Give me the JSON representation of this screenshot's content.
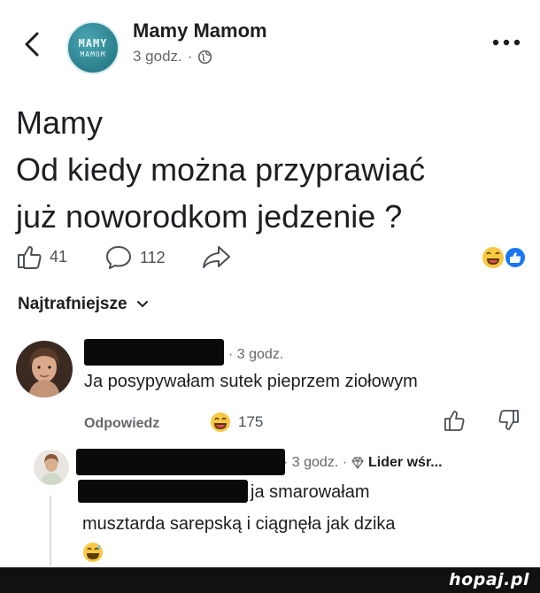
{
  "header": {
    "page_name": "Mamy Mamom",
    "time": "3 godz.",
    "separator": "·",
    "logo_text_line1": "MAMY",
    "logo_text_line2": "MAMOM"
  },
  "post": {
    "text_lines": [
      "Mamy",
      "Od kiedy można przyprawiać",
      "już noworodkom jedzenie ?"
    ]
  },
  "actions": {
    "likes": "41",
    "comments": "112"
  },
  "comments_section": {
    "sort_label": "Najtrafniejsze"
  },
  "comment1": {
    "time": "· 3 godz.",
    "text": "Ja posypywałam sutek pieprzem ziołowym",
    "reply_label": "Odpowiedz",
    "reaction_count": "175"
  },
  "comment2": {
    "time": "· 3 godz. ·",
    "badge": "Lider wśr...",
    "line1": "ja smarowałam",
    "line2": "musztarda sarepską i ciągnęła jak dzika"
  },
  "watermark": {
    "text": "hopaj.pl"
  },
  "colors": {
    "text": "#1c1e21",
    "secondary": "#65676b",
    "like_blue": "#1877f2",
    "emoji_yellow": "#f7c843",
    "logo_teal": "#2a7f8c"
  },
  "icons": [
    "back-icon",
    "globe-icon",
    "more-icon",
    "thumbs-up-icon",
    "comment-icon",
    "share-icon",
    "laugh-reaction-icon",
    "like-reaction-icon",
    "chevron-down-icon",
    "thumbs-down-icon",
    "diamond-icon"
  ]
}
